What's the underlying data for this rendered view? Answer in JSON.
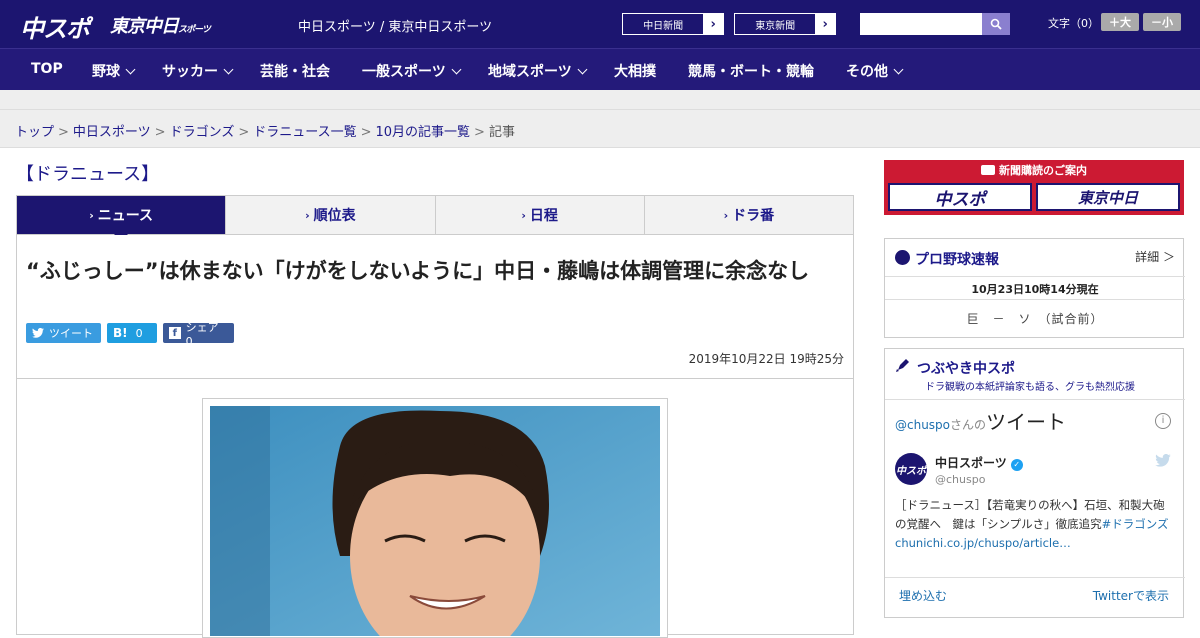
{
  "header": {
    "logo_main": "中スポ",
    "logo_tokyo": "東京中日",
    "logo_tokyo_small": "スポーツ",
    "site_names": "中日スポーツ / 東京中日スポーツ",
    "btn_chunichi": "中日新聞",
    "btn_tokyo": "東京新聞",
    "search_placeholder": "",
    "font_size_label": "文字（0）",
    "font_plus": "＋大",
    "font_minus": "－小"
  },
  "nav": [
    {
      "label": "TOP",
      "has_menu": false
    },
    {
      "label": "野球",
      "has_menu": true
    },
    {
      "label": "サッカー",
      "has_menu": true
    },
    {
      "label": "芸能・社会",
      "has_menu": false
    },
    {
      "label": "一般スポーツ",
      "has_menu": true
    },
    {
      "label": "地域スポーツ",
      "has_menu": true
    },
    {
      "label": "大相撲",
      "has_menu": false
    },
    {
      "label": "競馬・ボート・競輪",
      "has_menu": false
    },
    {
      "label": "その他",
      "has_menu": true
    }
  ],
  "breadcrumb": [
    "トップ",
    "中日スポーツ",
    "ドラゴンズ",
    "ドラニュース一覧",
    "10月の記事一覧",
    "記事"
  ],
  "section_title": "【ドラニュース】",
  "tabs": [
    "ニュース",
    "順位表",
    "日程",
    "ドラ番"
  ],
  "article": {
    "headline": "“ふじっしー”は休まない「けがをしないように」中日・藤嶋は体調管理に余念なし",
    "share_tweet": "ツイート",
    "share_hatena": "0",
    "share_fb": "シェア 0",
    "pubdate": "2019年10月22日 19時25分"
  },
  "sidebar": {
    "subscribe_title": "新聞購読のご案内",
    "sub_chuspo": "中スポ",
    "sub_tokyo": "東京中日",
    "baseball_title": "プロ野球速報",
    "baseball_detail": "詳細 ＞",
    "baseball_time": "10月23日10時14分現在",
    "baseball_game": "巨　－　ソ　（試合前）",
    "tweets_title": "つぶやき中スポ",
    "tweets_sub": "ドラ観戦の本紙評論家も語る、グラも熱烈応援",
    "tw_head_user": "@chuspo",
    "tw_head_san": "さんの",
    "tw_head_big": "ツイート",
    "tw_avatar": "中スポ",
    "tw_name": "中日スポーツ",
    "tw_handle": "@chuspo",
    "tw_text_main": "［ドラニュース］【若竜実りの秋へ】石垣、和製大砲の覚醒へ　鍵は「シンプルさ」徹底追究",
    "tw_text_tag": "#ドラゴンズ",
    "tw_text_link": "chunichi.co.jp/chuspo/article…",
    "tw_embed": "埋め込む",
    "tw_view": "Twitterで表示"
  },
  "colors": {
    "brand": "#1c1570",
    "accent_red": "#cc1a33",
    "link": "#1d1a8a"
  }
}
